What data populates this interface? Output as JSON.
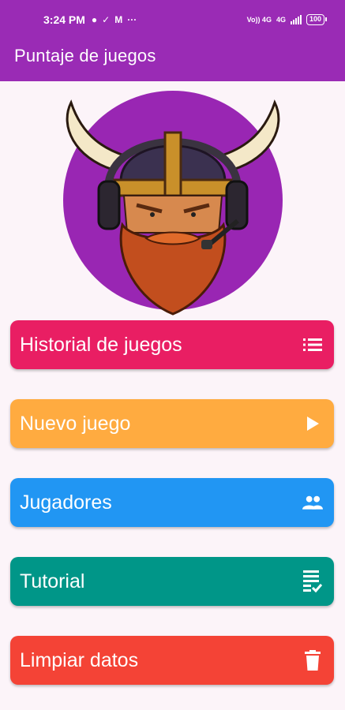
{
  "status_bar": {
    "time": "3:24 PM",
    "network_1": "Vo)) 4G",
    "network_2": "4G",
    "battery": "100"
  },
  "app": {
    "title": "Puntaje de juegos",
    "avatar_icon": "viking-warrior-headset-logo"
  },
  "menu": {
    "history": {
      "label": "Historial de juegos",
      "icon": "list-icon",
      "color": "#e91e63"
    },
    "new_game": {
      "label": "Nuevo juego",
      "icon": "play-icon",
      "color": "#ffab40"
    },
    "players": {
      "label": "Jugadores",
      "icon": "people-icon",
      "color": "#2196f3"
    },
    "tutorial": {
      "label": "Tutorial",
      "icon": "checklist-icon",
      "color": "#009688"
    },
    "clear": {
      "label": "Limpiar datos",
      "icon": "trash-icon",
      "color": "#f44336"
    }
  },
  "colors": {
    "appbar": "#9a2bb5",
    "background": "#fcf4f9",
    "avatar_bg": "#9926b3"
  }
}
